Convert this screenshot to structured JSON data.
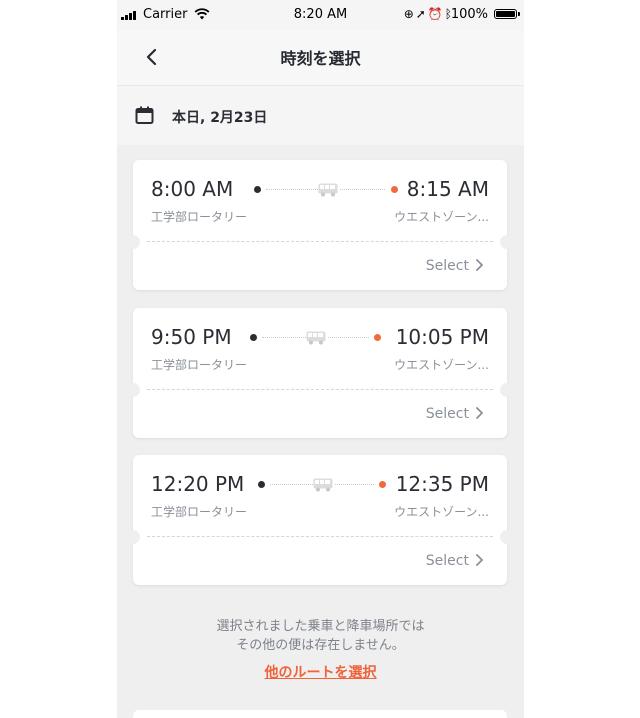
{
  "status_bar": {
    "carrier": "Carrier",
    "time": "8:20 AM",
    "battery": "100%"
  },
  "nav": {
    "title": "時刻を選択",
    "back_icon": "chevron-left-icon"
  },
  "date": {
    "label": "本日, 2月23日",
    "icon": "calendar-icon"
  },
  "trips": [
    {
      "depart_time": "8:00 AM",
      "arrive_time": "8:15 AM",
      "depart_stop": "工学部ロータリー",
      "arrive_stop": "ウエストゾーン...",
      "select_label": "Select"
    },
    {
      "depart_time": "9:50 PM",
      "arrive_time": "10:05 PM",
      "depart_stop": "工学部ロータリー",
      "arrive_stop": "ウエストゾーン...",
      "select_label": "Select"
    },
    {
      "depart_time": "12:20 PM",
      "arrive_time": "12:35 PM",
      "depart_stop": "工学部ロータリー",
      "arrive_stop": "ウエストゾーン...",
      "select_label": "Select"
    }
  ],
  "footer": {
    "note_line1": "選択されました乗車と降車場所では",
    "note_line2": "その他の便は存在しません。",
    "other_route_link": "他のルートを選択"
  },
  "colors": {
    "accent": "#f26a3b",
    "text": "#2a2d34",
    "muted": "#8a9099"
  }
}
